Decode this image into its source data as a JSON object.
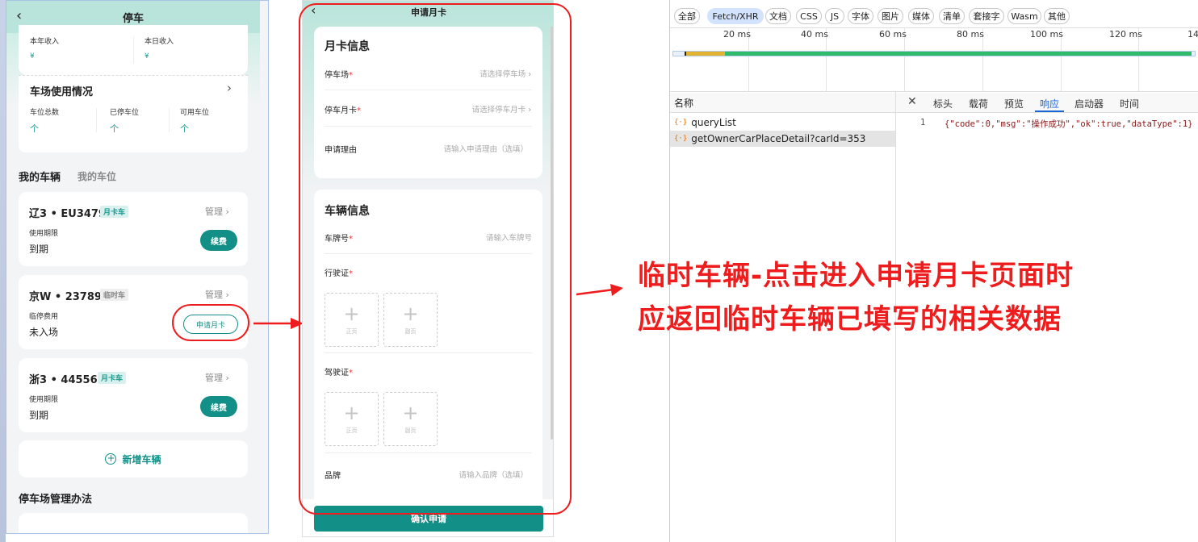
{
  "left": {
    "header_title": "停车",
    "back_glyph": "‹",
    "income": {
      "year_label": "本年收入",
      "year_value": "¥",
      "day_label": "本日收入",
      "day_value": "¥"
    },
    "usage": {
      "title": "车场使用情况",
      "total_label": "车位总数",
      "total_value": "个",
      "parked_label": "已停车位",
      "parked_value": "个",
      "free_label": "可用车位",
      "free_value": "个"
    },
    "tabs": {
      "vehicles": "我的车辆",
      "spaces": "我的车位"
    },
    "vehicles": [
      {
        "plate": "辽3 • EU3479",
        "tag": "月卡车",
        "manage": "管理",
        "info_label": "使用期限",
        "info_value": "到期",
        "action": "续费"
      },
      {
        "plate": "京W • 237893",
        "tag": "临时车",
        "manage": "管理",
        "info_label": "临停费用",
        "info_value": "未入场",
        "action": "申请月卡"
      },
      {
        "plate": "浙3 • 445566",
        "tag": "月卡车",
        "manage": "管理",
        "info_label": "使用期限",
        "info_value": "到期",
        "action": "续费"
      }
    ],
    "add_vehicle": "新增车辆",
    "rules_title": "停车场管理办法"
  },
  "mid": {
    "header_title": "申请月卡",
    "back_glyph": "‹",
    "card_section": "月卡信息",
    "lot_label": "停车场",
    "lot_placeholder": "请选择停车场",
    "card_label": "停车月卡",
    "card_placeholder": "请选择停车月卡",
    "reason_label": "申请理由",
    "reason_placeholder": "请输入申请理由（选填）",
    "vehicle_section": "车辆信息",
    "plate_label": "车牌号",
    "plate_placeholder": "请输入车牌号",
    "license_label": "行驶证",
    "driver_label": "驾驶证",
    "front_cap": "正页",
    "back_cap": "副页",
    "brand_label": "品牌",
    "brand_placeholder": "请输入品牌（选填）",
    "confirm": "确认申请"
  },
  "devtools": {
    "filters": [
      "全部",
      "Fetch/XHR",
      "文档",
      "CSS",
      "JS",
      "字体",
      "图片",
      "媒体",
      "清单",
      "套接字",
      "Wasm",
      "其他"
    ],
    "active_filter": "Fetch/XHR",
    "ticks": [
      "20 ms",
      "40 ms",
      "60 ms",
      "80 ms",
      "100 ms",
      "120 ms",
      "140"
    ],
    "name_header": "名称",
    "requests": [
      "queryList",
      "getOwnerCarPlaceDetail?carId=353"
    ],
    "detail_tabs": [
      "标头",
      "载荷",
      "预览",
      "响应",
      "启动器",
      "时间"
    ],
    "active_detail_tab": "响应",
    "close_glyph": "✕",
    "response": {
      "line_no": "1",
      "text": "{\"code\":0,\"msg\":\"操作成功\",\"ok\":true,\"dataType\":1}"
    }
  },
  "annotation": {
    "line1": "临时车辆-点击进入申请月卡页面时",
    "line2": "应返回临时车辆已填写的相关数据"
  },
  "colors": {
    "accent": "#128f86",
    "annotation": "#ee1c1c",
    "header_bg": "#b9e4db"
  }
}
